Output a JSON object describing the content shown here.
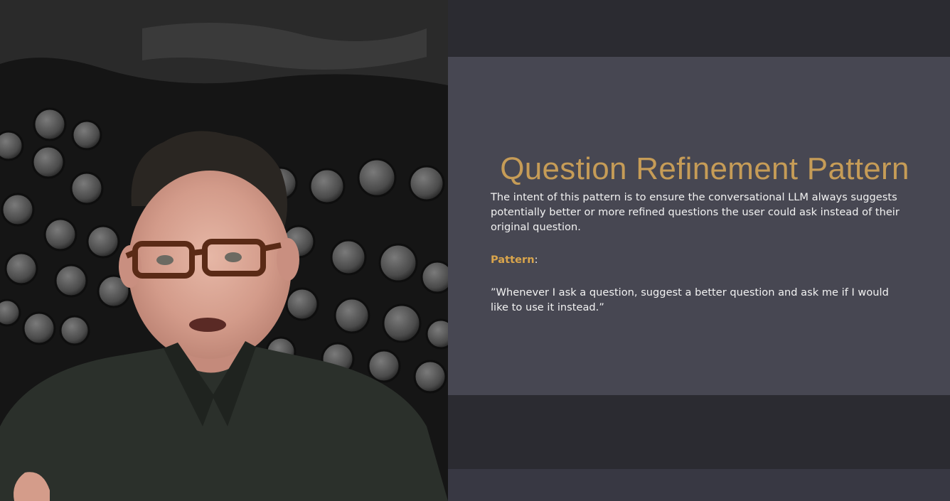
{
  "slide": {
    "title": "Question Refinement Pattern",
    "intent": " The intent of this pattern is to ensure the conversational LLM always suggests potentially better or more refined questions the user could ask instead of their original question.",
    "pattern_label": "Pattern",
    "pattern_colon": ":",
    "pattern_text": "”Whenever I ask a question, suggest a better question and ask me if I would like to use it instead.”"
  },
  "colors": {
    "title": "#c69c57",
    "pattern_label": "#d9a54c",
    "slide_bg": "#474752",
    "band_bg": "#2b2b31"
  },
  "video": {
    "subject": "presenter speaking in front of typewriter keys background"
  }
}
